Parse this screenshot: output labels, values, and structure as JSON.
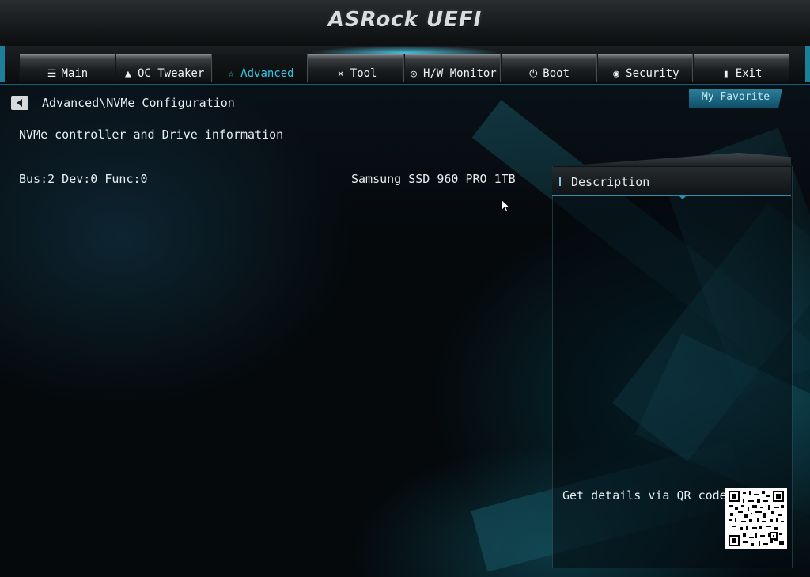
{
  "header": {
    "logo": "ASRock UEFI"
  },
  "tabs": [
    {
      "label": "Main",
      "icon": "list-icon",
      "active": false
    },
    {
      "label": "OC Tweaker",
      "icon": "rocket-icon",
      "active": false
    },
    {
      "label": "Advanced",
      "icon": "star-icon",
      "active": true
    },
    {
      "label": "Tool",
      "icon": "tools-icon",
      "active": false
    },
    {
      "label": "H/W Monitor",
      "icon": "monitor-icon",
      "active": false
    },
    {
      "label": "Boot",
      "icon": "power-icon",
      "active": false
    },
    {
      "label": "Security",
      "icon": "shield-icon",
      "active": false
    },
    {
      "label": "Exit",
      "icon": "door-icon",
      "active": false
    }
  ],
  "breadcrumb": "Advanced\\NVMe Configuration",
  "favorite_button": "My Favorite",
  "content": {
    "section_title": "NVMe controller and Drive information",
    "rows": [
      {
        "label": "Bus:2 Dev:0 Func:0",
        "value": "Samsung SSD 960 PRO 1TB"
      }
    ]
  },
  "description": {
    "title": "Description",
    "qr_text": "Get details via QR code"
  },
  "colors": {
    "accent": "#37c6e8",
    "panel_border": "#2a8fb0"
  }
}
